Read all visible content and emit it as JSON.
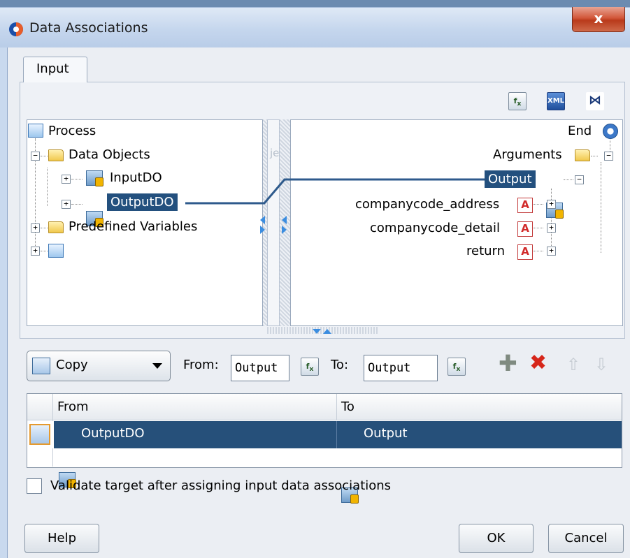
{
  "window": {
    "title": "Data Associations",
    "close_label": "x"
  },
  "tabs": [
    {
      "label": "Input"
    }
  ],
  "toolbar": {
    "fx_icon": "fx-expression-icon",
    "xml_icon": "xml-icon",
    "xml_label": "XML",
    "autoconnect_icon": "auto-connect-icon",
    "autoconnect_glyph": "⋈"
  },
  "source_tree": {
    "root": "Process",
    "data_objects": "Data Objects",
    "input_do": "InputDO",
    "output_do": "OutputDO",
    "predefined": "Predefined Variables"
  },
  "target_tree": {
    "root": "End",
    "arguments": "Arguments",
    "output": "Output",
    "items": [
      "companycode_address",
      "companycode_detail",
      "return"
    ]
  },
  "middle": {
    "label": "je"
  },
  "copy_row": {
    "operation": "Copy",
    "from_label": "From:",
    "from_value": "Output",
    "to_label": "To:",
    "to_value": "Output",
    "add_glyph": "✚",
    "delete_glyph": "✖",
    "up_glyph": "⇧",
    "down_glyph": "⇩"
  },
  "table": {
    "columns": [
      "From",
      "To"
    ],
    "rows": [
      {
        "from": "OutputDO",
        "to": "Output"
      }
    ]
  },
  "validate": {
    "label": "Validate target after assigning input data associations",
    "checked": false
  },
  "buttons": {
    "help": "Help",
    "ok": "OK",
    "cancel": "Cancel"
  },
  "colors": {
    "selection": "#23507e",
    "mapping_line": "#2e5a8c",
    "accent_blue": "#3b8de0"
  }
}
